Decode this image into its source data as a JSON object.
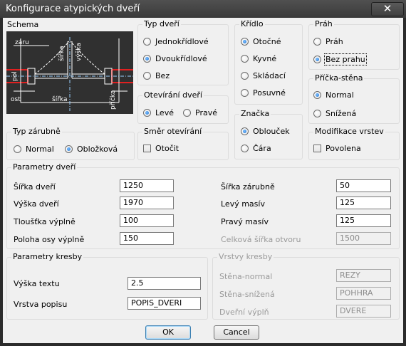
{
  "window": {
    "title": "Konfigurace atypických dveří",
    "close_symbol": "✕"
  },
  "schema": {
    "label": "Schema",
    "drawing_labels": {
      "zaru": "záru",
      "sirka_top": "šířka",
      "vyska": "výška",
      "pol": "pol",
      "ost": "ost",
      "sirka_bottom": "šířka",
      "pricka": "příčka"
    }
  },
  "typ_dveri": {
    "label": "Typ dveří",
    "options": [
      {
        "label": "Jednokřídlové",
        "checked": false
      },
      {
        "label": "Dvoukřídlové",
        "checked": true
      },
      {
        "label": "Bez",
        "checked": false
      }
    ]
  },
  "kridlo": {
    "label": "Křídlo",
    "options": [
      {
        "label": "Otočné",
        "checked": true
      },
      {
        "label": "Kyvné",
        "checked": false
      },
      {
        "label": "Skládací",
        "checked": false
      },
      {
        "label": "Posuvné",
        "checked": false
      }
    ]
  },
  "prah": {
    "label": "Práh",
    "options": [
      {
        "label": "Práh",
        "checked": false
      },
      {
        "label": "Bez prahu",
        "checked": true
      }
    ]
  },
  "pricka_stena": {
    "label": "Příčka-stěna",
    "options": [
      {
        "label": "Normal",
        "checked": true
      },
      {
        "label": "Snížená",
        "checked": false
      }
    ]
  },
  "otevirani": {
    "label": "Otevírání dveří",
    "options": [
      {
        "label": "Levé",
        "checked": true
      },
      {
        "label": "Pravé",
        "checked": false
      }
    ]
  },
  "znacka": {
    "label": "Značka",
    "options": [
      {
        "label": "Oblouček",
        "checked": true
      },
      {
        "label": "Čára",
        "checked": false
      }
    ]
  },
  "typ_zarubne": {
    "label": "Typ zárubně",
    "options": [
      {
        "label": "Normal",
        "checked": false
      },
      {
        "label": "Obložková",
        "checked": true
      }
    ]
  },
  "smer": {
    "label": "Směr otevírání",
    "checkbox_label": "Otočit",
    "checked": false
  },
  "modifikace": {
    "label": "Modifikace vrstev",
    "checkbox_label": "Povolena",
    "checked": false
  },
  "parametry_dveri": {
    "label": "Parametry dveří",
    "left": [
      {
        "label": "Šířka dveří",
        "value": "1250"
      },
      {
        "label": "Výška dveří",
        "value": "1970"
      },
      {
        "label": "Tloušťka výplně",
        "value": "100"
      },
      {
        "label": "Poloha osy výplně",
        "value": "150"
      }
    ],
    "right": [
      {
        "label": "Šířka zárubně",
        "value": "50",
        "enabled": true
      },
      {
        "label": "Levý masív",
        "value": "125",
        "enabled": true
      },
      {
        "label": "Pravý masív",
        "value": "125",
        "enabled": true
      },
      {
        "label": "Celková šířka otvoru",
        "value": "1500",
        "enabled": false
      }
    ]
  },
  "parametry_kresby": {
    "label": "Parametry kresby",
    "fields": [
      {
        "label": "Výška textu",
        "value": "2.5"
      },
      {
        "label": "Vrstva popisu",
        "value": "POPIS_DVERI"
      }
    ]
  },
  "vrstvy_kresby": {
    "label": "Vrstvy kresby",
    "fields": [
      {
        "label": "Stěna-normal",
        "value": "REZY"
      },
      {
        "label": "Stěna-snížená",
        "value": "POHHRA"
      },
      {
        "label": "Dveřní výplň",
        "value": "DVERE"
      }
    ]
  },
  "buttons": {
    "ok": "OK",
    "cancel": "Cancel"
  }
}
